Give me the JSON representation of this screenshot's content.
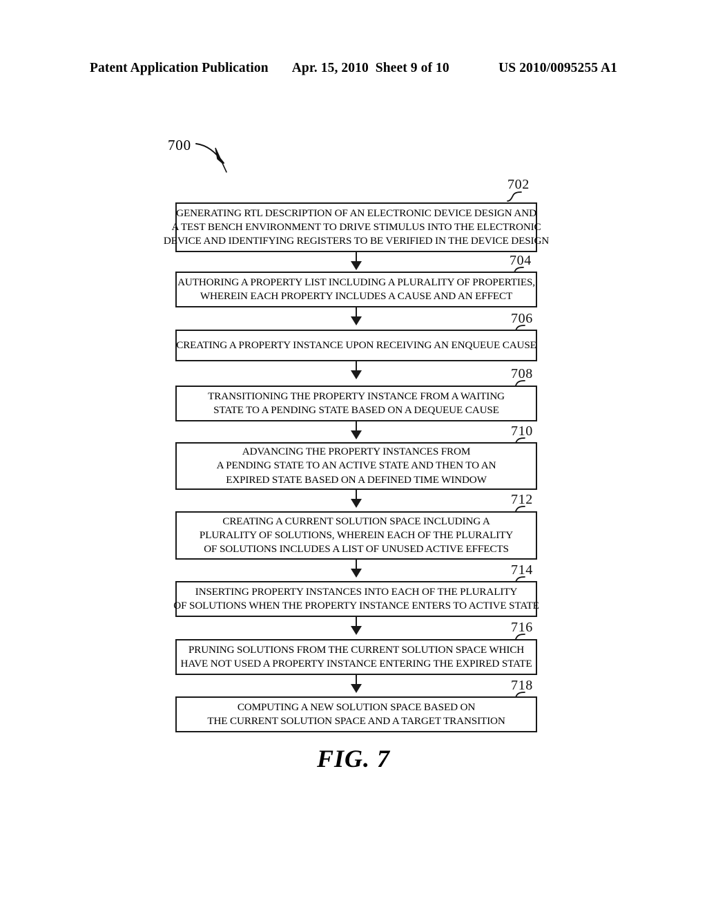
{
  "header": {
    "publication": "Patent Application Publication",
    "date": "Apr. 15, 2010",
    "sheet": "Sheet 9 of 10",
    "patent_number": "US 2010/0095255 A1"
  },
  "figure": {
    "caption": "FIG. 7",
    "diagram_label": "700",
    "type": "flowchart",
    "steps": [
      {
        "ref": "702",
        "lines": [
          "GENERATING RTL DESCRIPTION OF AN ELECTRONIC DEVICE DESIGN AND",
          "A TEST BENCH ENVIRONMENT TO DRIVE STIMULUS INTO THE ELECTRONIC",
          "DEVICE AND IDENTIFYING REGISTERS TO BE VERIFIED IN THE DEVICE DESIGN"
        ]
      },
      {
        "ref": "704",
        "lines": [
          "AUTHORING A PROPERTY LIST INCLUDING A PLURALITY OF PROPERTIES,",
          "WHEREIN EACH PROPERTY INCLUDES A CAUSE AND AN EFFECT"
        ]
      },
      {
        "ref": "706",
        "lines": [
          "CREATING A PROPERTY INSTANCE UPON RECEIVING AN ENQUEUE CAUSE"
        ]
      },
      {
        "ref": "708",
        "lines": [
          "TRANSITIONING THE PROPERTY INSTANCE FROM A WAITING",
          "STATE TO A PENDING STATE BASED ON A DEQUEUE CAUSE"
        ]
      },
      {
        "ref": "710",
        "lines": [
          "ADVANCING THE PROPERTY INSTANCES FROM",
          "A PENDING STATE TO AN ACTIVE STATE AND THEN TO AN",
          "EXPIRED STATE BASED ON A DEFINED TIME WINDOW"
        ]
      },
      {
        "ref": "712",
        "lines": [
          "CREATING A CURRENT SOLUTION SPACE INCLUDING A",
          "PLURALITY OF SOLUTIONS, WHEREIN EACH OF THE PLURALITY",
          "OF SOLUTIONS INCLUDES A LIST OF UNUSED ACTIVE EFFECTS"
        ]
      },
      {
        "ref": "714",
        "lines": [
          "INSERTING PROPERTY INSTANCES INTO EACH OF THE PLURALITY",
          "OF SOLUTIONS WHEN THE PROPERTY INSTANCE ENTERS TO ACTIVE STATE"
        ]
      },
      {
        "ref": "716",
        "lines": [
          "PRUNING SOLUTIONS FROM THE CURRENT SOLUTION SPACE WHICH",
          "HAVE NOT USED A PROPERTY INSTANCE ENTERING THE EXPIRED STATE"
        ]
      },
      {
        "ref": "718",
        "lines": [
          "COMPUTING A NEW SOLUTION SPACE BASED ON",
          "THE CURRENT SOLUTION SPACE AND A TARGET TRANSITION"
        ]
      }
    ]
  }
}
